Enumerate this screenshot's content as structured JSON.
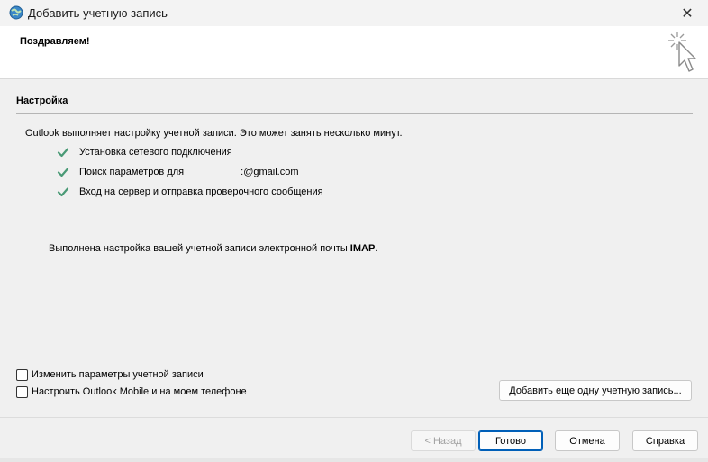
{
  "window": {
    "title": "Добавить учетную запись",
    "close_label": "✕"
  },
  "header": {
    "title": "Поздравляем!"
  },
  "setup": {
    "section_title": "Настройка",
    "intro": "Outlook выполняет настройку учетной записи. Это может занять несколько минут.",
    "steps": [
      {
        "label": "Установка сетевого подключения"
      },
      {
        "label": "Поиск параметров для",
        "email_suffix": ":@gmail.com"
      },
      {
        "label": "Вход на сервер и отправка проверочного сообщения"
      }
    ],
    "summary_prefix": "Выполнена настройка вашей учетной записи электронной почты ",
    "summary_protocol": "IMAP",
    "summary_suffix": "."
  },
  "options": {
    "change_settings": "Изменить параметры учетной записи",
    "setup_mobile": "Настроить Outlook Mobile и на моем телефоне"
  },
  "buttons": {
    "add_account": "Добавить еще одну учетную запись...",
    "back": "< Назад",
    "finish": "Готово",
    "cancel": "Отмена",
    "help": "Справка"
  },
  "colors": {
    "check": "#4a9a76",
    "primary_border": "#005fb8"
  },
  "icons": {
    "app": "globe-icon",
    "wizard": "cursor-sparkle-icon",
    "step_status": "checkmark-icon"
  }
}
